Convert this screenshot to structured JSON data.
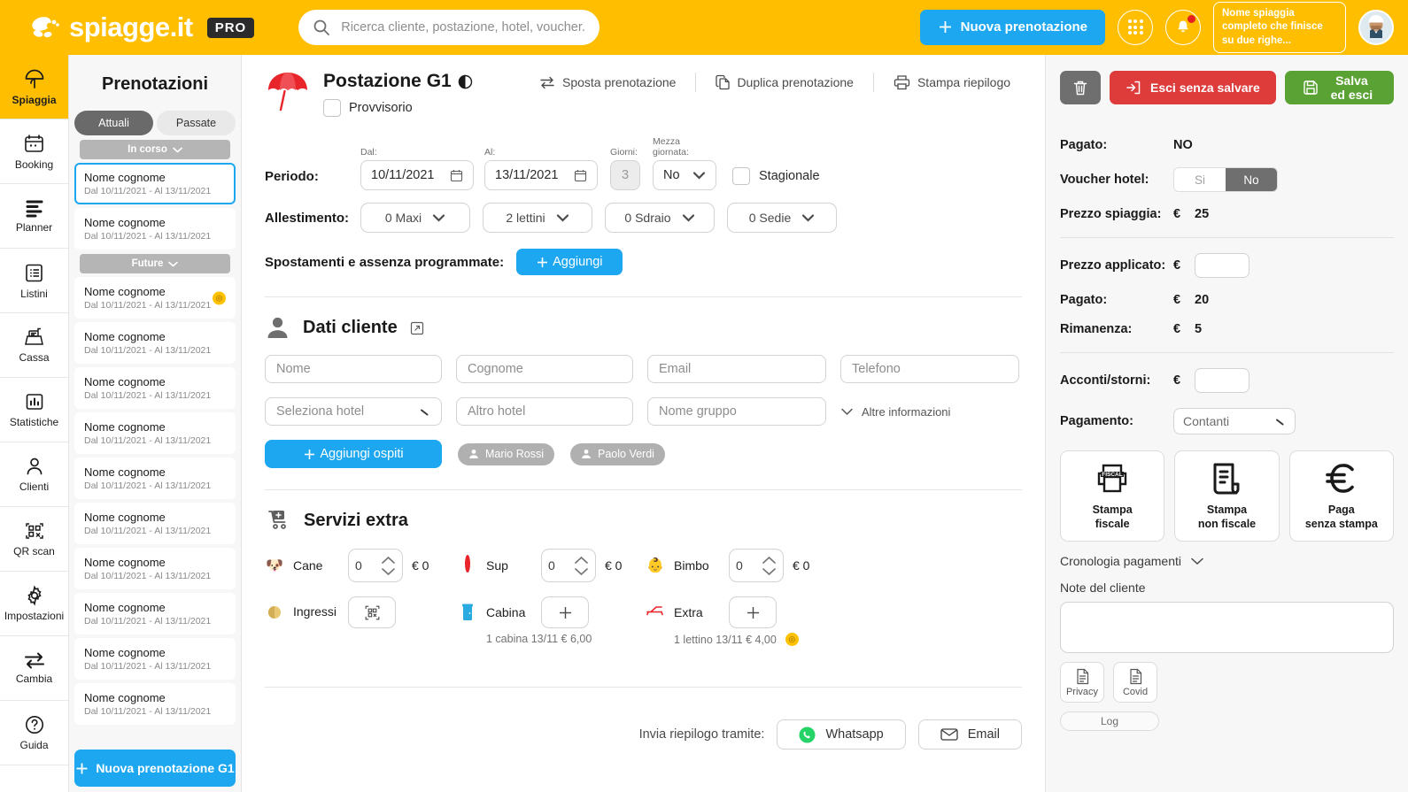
{
  "topbar": {
    "brand": "spiagge.it",
    "pro_badge": "PRO",
    "search_placeholder": "Ricerca cliente, postazione, hotel, voucher...",
    "new_booking_label": "Nuova prenotazione",
    "beach_name": "Nome spiaggia completo che finisce su due righe...",
    "accent_yellow": "#FFBF00",
    "accent_blue": "#1CA7F0"
  },
  "rail": {
    "items": [
      {
        "label": "Spiaggia",
        "icon": "umbrella-icon",
        "active": true
      },
      {
        "label": "Booking",
        "icon": "calendar-icon",
        "active": false
      },
      {
        "label": "Planner",
        "icon": "planner-bars-icon",
        "active": false
      },
      {
        "label": "Listini",
        "icon": "list-icon",
        "active": false
      },
      {
        "label": "Cassa",
        "icon": "cash-register-icon",
        "active": false
      },
      {
        "label": "Statistiche",
        "icon": "bar-chart-icon",
        "active": false
      },
      {
        "label": "Clienti",
        "icon": "person-icon",
        "active": false
      },
      {
        "label": "QR scan",
        "icon": "qr-code-icon",
        "active": false
      },
      {
        "label": "Impostazioni",
        "icon": "gear-icon",
        "active": false
      },
      {
        "label": "Cambia",
        "icon": "swap-arrows-icon",
        "active": false
      },
      {
        "label": "Guida",
        "icon": "question-circle-icon",
        "active": false
      }
    ]
  },
  "reservations": {
    "title": "Prenotazioni",
    "tabs": [
      {
        "label": "Attuali",
        "active": true
      },
      {
        "label": "Passate",
        "active": false
      }
    ],
    "groups": [
      {
        "label": "In corso",
        "items": [
          {
            "name": "Nome cognome",
            "dates": "Dal 10/11/2021 - Al 13/11/2021",
            "selected": true,
            "badge": false
          },
          {
            "name": "Nome cognome",
            "dates": "Dal 10/11/2021 - Al 13/11/2021",
            "selected": false,
            "badge": false
          }
        ]
      },
      {
        "label": "Future",
        "items": [
          {
            "name": "Nome cognome",
            "dates": "Dal 10/11/2021 - Al 13/11/2021",
            "selected": false,
            "badge": true
          },
          {
            "name": "Nome cognome",
            "dates": "Dal 10/11/2021 - Al 13/11/2021",
            "selected": false,
            "badge": false
          },
          {
            "name": "Nome cognome",
            "dates": "Dal 10/11/2021 - Al 13/11/2021",
            "selected": false,
            "badge": false
          },
          {
            "name": "Nome cognome",
            "dates": "Dal 10/11/2021 - Al 13/11/2021",
            "selected": false,
            "badge": false
          },
          {
            "name": "Nome cognome",
            "dates": "Dal 10/11/2021 - Al 13/11/2021",
            "selected": false,
            "badge": false
          },
          {
            "name": "Nome cognome",
            "dates": "Dal 10/11/2021 - Al 13/11/2021",
            "selected": false,
            "badge": false
          },
          {
            "name": "Nome cognome",
            "dates": "Dal 10/11/2021 - Al 13/11/2021",
            "selected": false,
            "badge": false
          },
          {
            "name": "Nome cognome",
            "dates": "Dal 10/11/2021 - Al 13/11/2021",
            "selected": false,
            "badge": false
          },
          {
            "name": "Nome cognome",
            "dates": "Dal 10/11/2021 - Al 13/11/2021",
            "selected": false,
            "badge": false
          },
          {
            "name": "Nome cognome",
            "dates": "Dal 10/11/2021 - Al 13/11/2021",
            "selected": false,
            "badge": false
          }
        ]
      }
    ],
    "new_button_label": "Nuova prenotazione G1"
  },
  "main": {
    "station_title": "Postazione G1",
    "provisional_label": "Provvisorio",
    "actions": [
      {
        "label": "Sposta prenotazione",
        "icon": "swap-arrows-icon"
      },
      {
        "label": "Duplica prenotazione",
        "icon": "copy-icon"
      },
      {
        "label": "Stampa riepilogo",
        "icon": "printer-icon"
      }
    ],
    "periodo": {
      "label": "Periodo:",
      "dal_caption": "Dal:",
      "dal_value": "10/11/2021",
      "al_caption": "Al:",
      "al_value": "13/11/2021",
      "giorni_caption": "Giorni:",
      "giorni_value": "3",
      "mezza_caption": "Mezza giornata:",
      "mezza_value": "No",
      "stagionale_label": "Stagionale"
    },
    "allestimento": {
      "label": "Allestimento:",
      "options": [
        "0 Maxi",
        "2 lettini",
        "0 Sdraio",
        "0 Sedie"
      ]
    },
    "spostamenti": {
      "label": "Spostamenti e assenza programmate:",
      "button": "Aggiungi"
    },
    "dati_cliente": {
      "title": "Dati cliente",
      "fields_row1": [
        "Nome",
        "Cognome",
        "Email",
        "Telefono"
      ],
      "hotel_select": "Seleziona hotel",
      "altro_hotel": "Altro hotel",
      "nome_gruppo": "Nome gruppo",
      "altre_informazioni": "Altre informazioni",
      "add_guests_button": "Aggiungi ospiti",
      "guests": [
        "Mario Rossi",
        "Paolo Verdi"
      ]
    },
    "servizi_extra": {
      "title": "Servizi extra",
      "items": [
        {
          "name": "Cane",
          "icon": "dog-icon",
          "type": "stepper",
          "value": "0",
          "price": "€ 0"
        },
        {
          "name": "Sup",
          "icon": "sup-icon",
          "type": "stepper",
          "value": "0",
          "price": "€ 0"
        },
        {
          "name": "Bimbo",
          "icon": "baby-icon",
          "type": "stepper",
          "value": "0",
          "price": "€ 0"
        },
        {
          "name": "Ingressi",
          "icon": "qr-code-icon",
          "type": "qr"
        },
        {
          "name": "Cabina",
          "icon": "cabin-icon",
          "type": "plus",
          "note": "1 cabina 13/11 € 6,00"
        },
        {
          "name": "Extra",
          "icon": "lounger-icon",
          "type": "plus",
          "note": "1 lettino 13/11 € 4,00",
          "badge": true
        }
      ]
    },
    "send_summary": {
      "label": "Invia riepilogo tramite:",
      "whatsapp": "Whatsapp",
      "email": "Email"
    }
  },
  "right_panel": {
    "delete_label": "",
    "exit_label": "Esci senza salvare",
    "save_label": "Salva ed esci",
    "pagato_top": {
      "key": "Pagato:",
      "value": "NO"
    },
    "voucher": {
      "key": "Voucher hotel:",
      "yes": "Si",
      "no": "No",
      "selected": "No"
    },
    "prezzo_spiaggia": {
      "key": "Prezzo spiaggia:",
      "eur": "€",
      "value": "25"
    },
    "prezzo_applicato": {
      "key": "Prezzo applicato:",
      "eur": "€",
      "value": ""
    },
    "pagato": {
      "key": "Pagato:",
      "eur": "€",
      "value": "20"
    },
    "rimanenza": {
      "key": "Rimanenza:",
      "eur": "€",
      "value": "5"
    },
    "acconti": {
      "key": "Acconti/storni:",
      "eur": "€",
      "value": ""
    },
    "pagamento": {
      "key": "Pagamento:",
      "value": "Contanti"
    },
    "pay_cards": [
      {
        "label_line1": "Stampa",
        "label_line2": "fiscale",
        "icon": "fiscal-printer-icon"
      },
      {
        "label_line1": "Stampa",
        "label_line2": "non fiscale",
        "icon": "receipt-icon"
      },
      {
        "label_line1": "Paga",
        "label_line2": "senza stampa",
        "icon": "euro-icon"
      }
    ],
    "cronologia": "Cronologia pagamenti",
    "note_label": "Note del cliente",
    "note_value": "",
    "docs": [
      {
        "label": "Privacy",
        "icon": "document-icon"
      },
      {
        "label": "Covid",
        "icon": "document-icon"
      }
    ],
    "log_label": "Log"
  }
}
